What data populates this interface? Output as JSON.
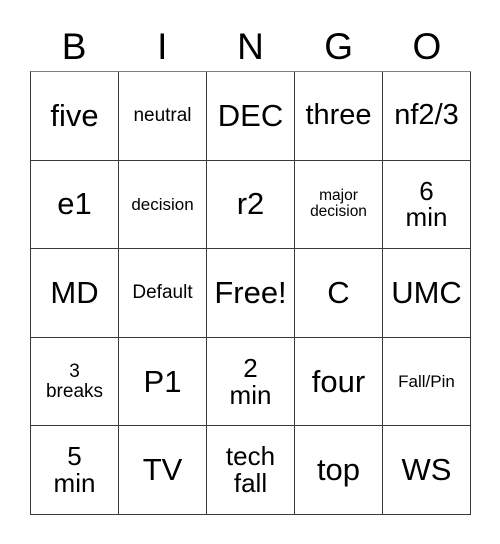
{
  "card": {
    "title": "BINGO",
    "free_space_label": "Free!",
    "columns": [
      {
        "letter": "B"
      },
      {
        "letter": "I"
      },
      {
        "letter": "N"
      },
      {
        "letter": "G"
      },
      {
        "letter": "O"
      }
    ],
    "rows": [
      {
        "cells": [
          {
            "text": "five",
            "size": "xl"
          },
          {
            "text": "neutral",
            "size": "sm"
          },
          {
            "text": "DEC",
            "size": "xl"
          },
          {
            "text": "three",
            "size": "lg"
          },
          {
            "text": "nf2/3",
            "size": "lg"
          }
        ]
      },
      {
        "cells": [
          {
            "text": "e1",
            "size": "xl"
          },
          {
            "text": "decision",
            "size": "xs"
          },
          {
            "text": "r2",
            "size": "xl"
          },
          {
            "text": "major\ndecision",
            "size": "xxs"
          },
          {
            "text": "6\nmin",
            "size": "md"
          }
        ]
      },
      {
        "cells": [
          {
            "text": "MD",
            "size": "xl"
          },
          {
            "text": "Default",
            "size": "sm"
          },
          {
            "text": "Free!",
            "size": "xl"
          },
          {
            "text": "C",
            "size": "xl"
          },
          {
            "text": "UMC",
            "size": "xl"
          }
        ]
      },
      {
        "cells": [
          {
            "text": "3\nbreaks",
            "size": "sm"
          },
          {
            "text": "P1",
            "size": "xl"
          },
          {
            "text": "2\nmin",
            "size": "md"
          },
          {
            "text": "four",
            "size": "xl"
          },
          {
            "text": "Fall/Pin",
            "size": "xs"
          }
        ]
      },
      {
        "cells": [
          {
            "text": "5\nmin",
            "size": "md"
          },
          {
            "text": "TV",
            "size": "xl"
          },
          {
            "text": "tech\nfall",
            "size": "md"
          },
          {
            "text": "top",
            "size": "xl"
          },
          {
            "text": "WS",
            "size": "xl"
          }
        ]
      }
    ]
  },
  "colors": {
    "background": "#ffffff",
    "grid_line": "#3a3a3a",
    "text": "#000000"
  }
}
